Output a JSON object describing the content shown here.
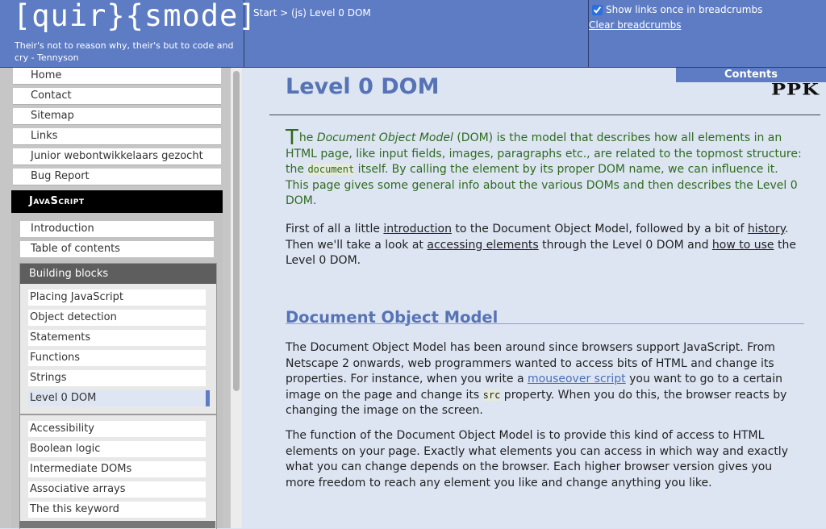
{
  "header": {
    "logo": "[quir}{smode]",
    "tagline": "Their's not to reason why, their's but to code and cry - Tennyson",
    "breadcrumb": "Start > (js) Level 0 DOM",
    "show_links_once": "Show links once in breadcrumbs",
    "show_links_once_checked": true,
    "clear_breadcrumbs": "Clear breadcrumbs"
  },
  "sidebar": {
    "top_items": [
      "Home",
      "Contact",
      "Sitemap",
      "Links",
      "Junior webontwikkelaars gezocht",
      "Bug Report"
    ],
    "section_title": "JavaScript",
    "section_items": [
      "Introduction",
      "Table of contents"
    ],
    "building_blocks": {
      "title": "Building blocks",
      "items": [
        "Placing JavaScript",
        "Object detection",
        "Statements",
        "Functions",
        "Strings",
        "Level 0 DOM"
      ],
      "active": "Level 0 DOM"
    },
    "more_items": [
      "Accessibility",
      "Boolean logic",
      "Intermediate DOMs",
      "Associative arrays",
      "The this keyword"
    ]
  },
  "content": {
    "contents_tab": "Contents",
    "logo_mark": "PPK",
    "title": "Level 0 DOM",
    "intro": {
      "drop_cap": "T",
      "t1": "he ",
      "em": "Document Object Model",
      "t2": " (DOM) is the model that describes how all elements in an HTML page, like input fields, images, paragraphs etc., are related to the topmost structure: the ",
      "code": "document",
      "t3": " itself. By calling the element by its proper DOM name, we can influence it. This page gives some general info about the various DOMs and then describes the Level 0 DOM."
    },
    "para2": {
      "t1": "First of all a little ",
      "link1": "introduction",
      "t2": " to the Document Object Model, followed by a bit of ",
      "link2": "history",
      "t3": ". Then we'll take a look at ",
      "link3": "accessing elements",
      "t4": " through the Level 0 DOM and ",
      "link4": "how to use",
      "t5": " the Level 0 DOM."
    },
    "section_heading": "Document Object Model",
    "dom_para1": {
      "t1": "The Document Object Model has been around since browsers support JavaScript. From Netscape 2 onwards, web programmers wanted to access bits of HTML and change its properties. For instance, when you write a ",
      "link": "mouseover script",
      "t2": " you want to go to a certain image on the page and change its ",
      "code": "src",
      "t3": " property. When you do this, the browser reacts by changing the image on the screen."
    },
    "dom_para2": "The function of the Document Object Model is to provide this kind of access to HTML elements on your page. Exactly what elements you can access in which way and exactly what you can change depends on the browser. Each higher browser version gives you more freedom to reach any element you like and change anything you like."
  }
}
